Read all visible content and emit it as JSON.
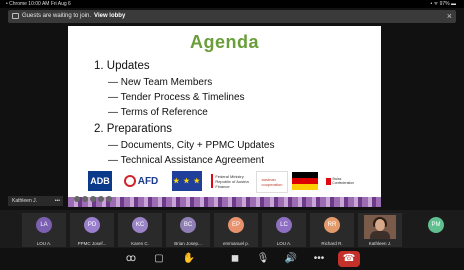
{
  "status": {
    "left": "• Chrome  10:00 AM  Fri Aug 6",
    "right": "• ᯤ 97% ▬"
  },
  "banner": {
    "text": "Guests are waiting to join.",
    "link": "View lobby",
    "close": "×"
  },
  "slide": {
    "title": "Agenda",
    "sections": [
      {
        "label": "1. Updates",
        "items": [
          "— New Team Members",
          "— Tender Process & Timelines",
          "— Terms of Reference"
        ]
      },
      {
        "label": "2. Preparations",
        "items": [
          "— Documents, City + PPMC Updates",
          "— Technical Assistance Agreement"
        ]
      }
    ],
    "logos": {
      "adb": "ADB",
      "afd": "AFD",
      "eu": "★ ★ ★",
      "fm": "Federal Ministry\nRepublic of Austria\nFinance",
      "ac": "austrian\ncooperation",
      "ch": "Swiss Confederation"
    }
  },
  "self_tile": {
    "name": "Kathleen J.",
    "more": "•••"
  },
  "participants": [
    {
      "initials": "LA",
      "name": "LOU A.",
      "color": "#7b5fb0"
    },
    {
      "initials": "PD",
      "name": "PPMC Josef...",
      "color": "#9b7fcf"
    },
    {
      "initials": "KC",
      "name": "Karen C.",
      "color": "#9b83c8"
    },
    {
      "initials": "BC",
      "name": "Brian Josep...",
      "color": "#8f7fb5"
    },
    {
      "initials": "EP",
      "name": "emmanuel p.",
      "color": "#e8916d"
    },
    {
      "initials": "LC",
      "name": "LOU A.",
      "color": "#8e6fc4"
    },
    {
      "initials": "RR",
      "name": "Richard R.",
      "color": "#e39a6a"
    },
    {
      "initials": "",
      "name": "Kathleen J.",
      "color": "#000000"
    },
    {
      "initials": "PM",
      "name": "",
      "color": "#5fbf8f"
    }
  ],
  "controls": {
    "people": "ꝏ",
    "chat": "▢",
    "raise": "✋",
    "camera": "◼",
    "mic": "🎙",
    "speaker": "🔊",
    "more": "•••",
    "end": "☎"
  }
}
